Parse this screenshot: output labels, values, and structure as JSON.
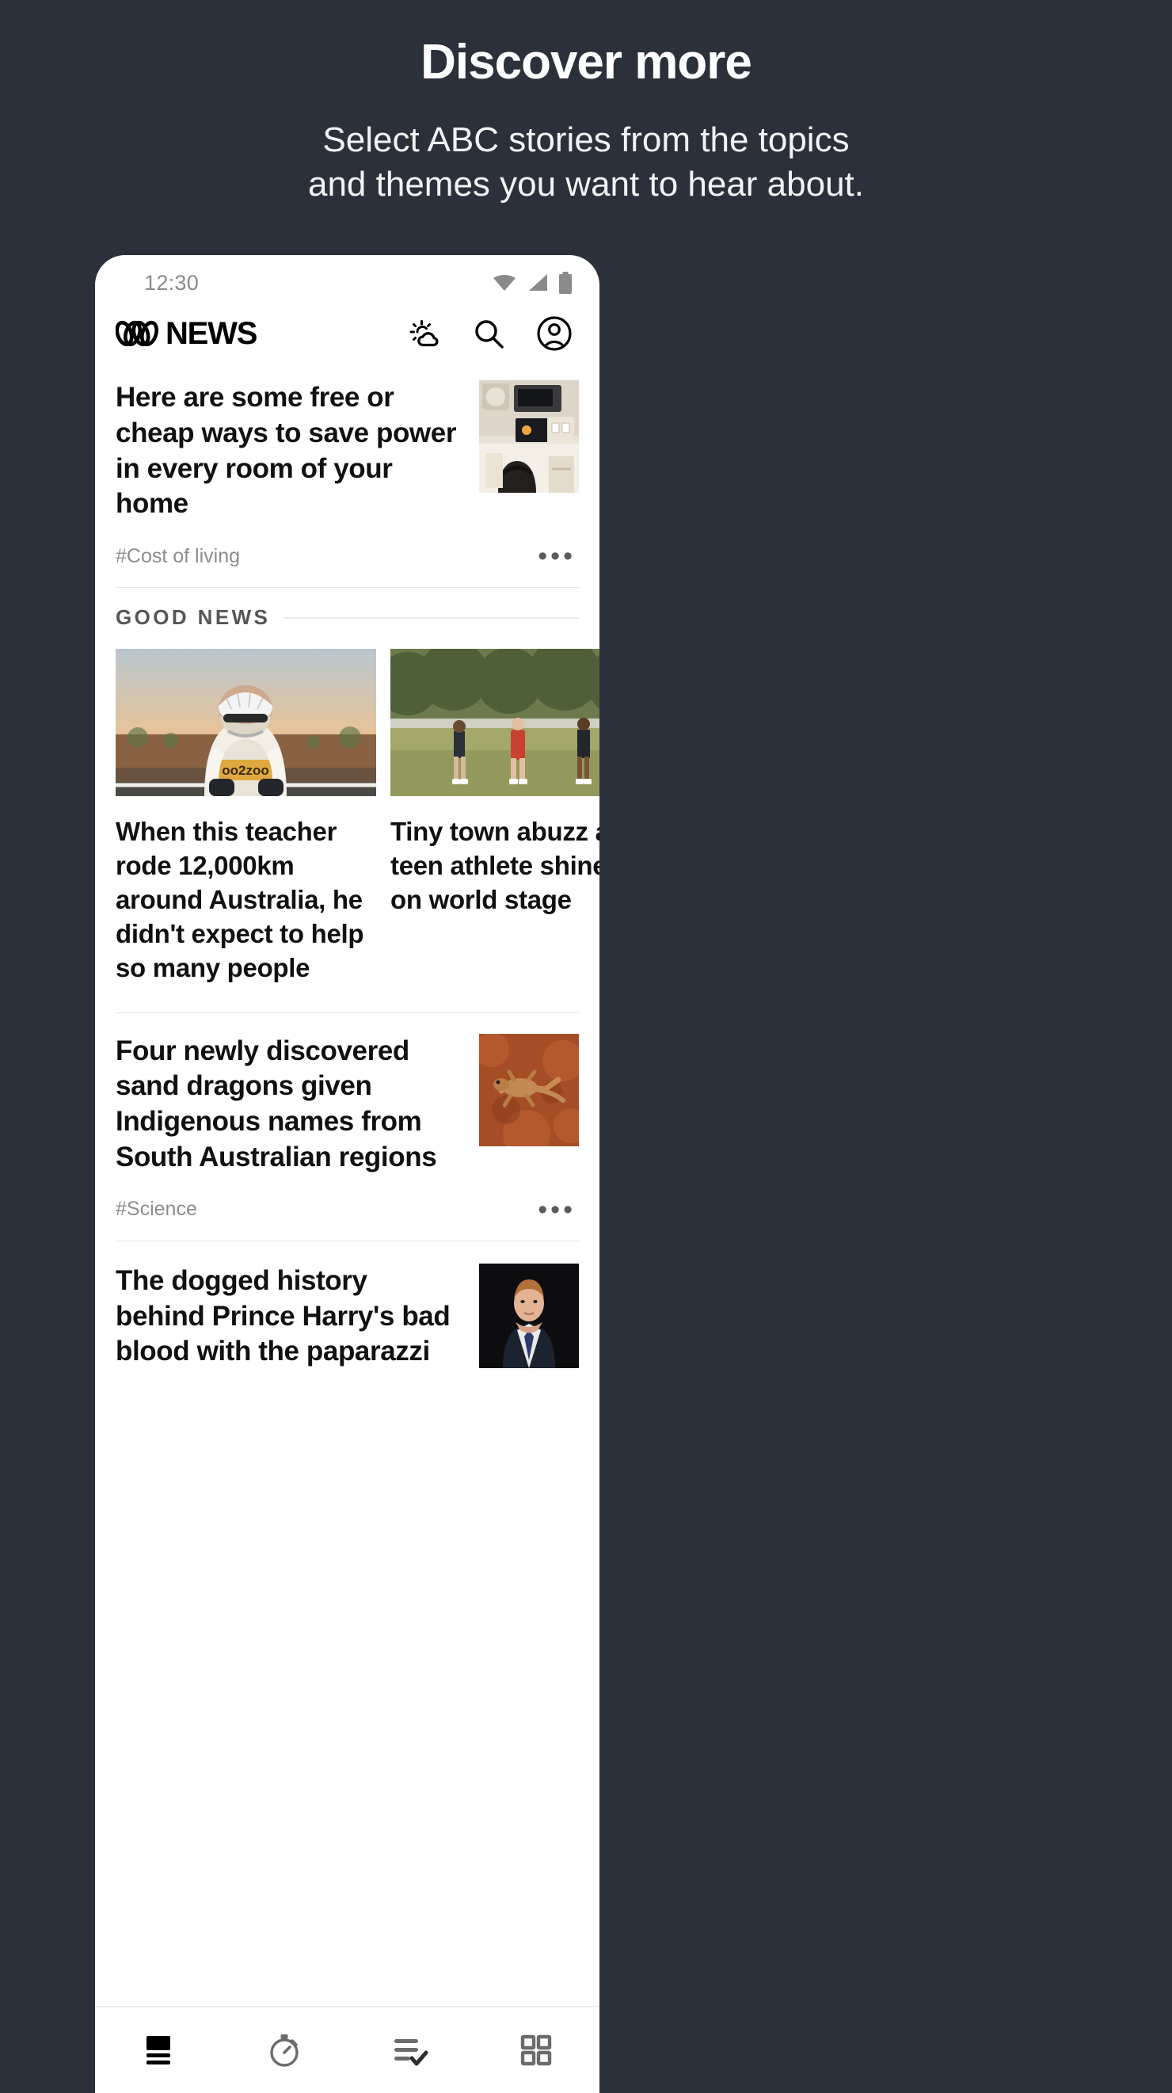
{
  "promo": {
    "title": "Discover more",
    "subtitle_line1": "Select ABC stories from the topics",
    "subtitle_line2": "and themes you want to hear about."
  },
  "colors": {
    "background": "#2b303a",
    "phone_surface": "#ffffff",
    "text_primary": "#111111",
    "text_muted": "#8d8d8d",
    "rule": "#e6e6e6"
  },
  "phone": {
    "statusbar": {
      "time": "12:30",
      "icons": [
        "wifi-icon",
        "cellular-signal-icon",
        "battery-icon"
      ]
    },
    "appbar": {
      "brand_mark": "abc-lissajous-logo",
      "brand_text": "NEWS",
      "actions": [
        {
          "name": "weather-icon",
          "label": "Weather"
        },
        {
          "name": "search-icon",
          "label": "Search"
        },
        {
          "name": "account-icon",
          "label": "Account"
        }
      ]
    },
    "lead_story": {
      "headline": "Here are some free or cheap ways to save power in every room of your home",
      "thumbnail": "kitchen-appliances-photo",
      "tag": "#Cost of living",
      "more_label": "•••"
    },
    "section": {
      "label": "GOOD NEWS",
      "cards": [
        {
          "image": "cyclist-in-outback-photo",
          "headline": "When this teacher rode 12,000km around Australia, he didn't expect to help so many people"
        },
        {
          "image": "teen-athletes-on-field-photo",
          "headline": "Tiny town abuzz as teen athlete shines on world stage"
        }
      ]
    },
    "story_science": {
      "headline": "Four newly discovered sand dragons given Indigenous names from South Australian regions",
      "thumbnail": "sand-dragon-lizard-photo",
      "tag": "#Science",
      "more_label": "•••"
    },
    "story_harry": {
      "headline": "The dogged history behind Prince Harry's bad blood with the paparazzi",
      "thumbnail": "prince-harry-photo"
    },
    "bottomnav": [
      {
        "name": "top-stories-icon",
        "active": true
      },
      {
        "name": "just-in-stopwatch-icon",
        "active": false
      },
      {
        "name": "my-news-checklist-icon",
        "active": false
      },
      {
        "name": "browse-grid-icon",
        "active": false
      }
    ]
  }
}
